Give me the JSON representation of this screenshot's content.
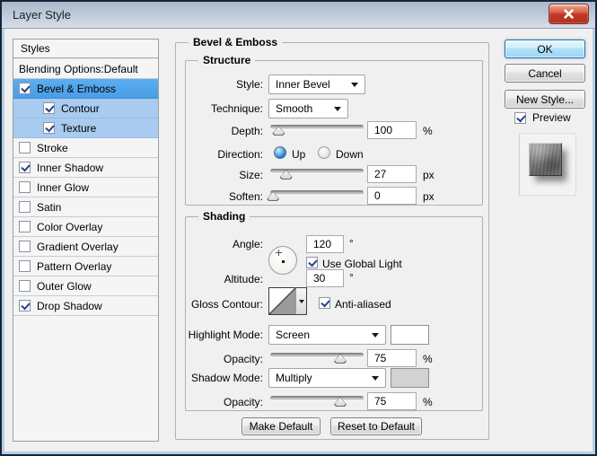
{
  "window": {
    "title": "Layer Style"
  },
  "sidebar": {
    "header": "Styles",
    "items": [
      {
        "label": "Blending Options:Default",
        "checked": null,
        "state": "none",
        "indent": false
      },
      {
        "label": "Bevel & Emboss",
        "checked": true,
        "state": "primary",
        "indent": false
      },
      {
        "label": "Contour",
        "checked": true,
        "state": "secondary",
        "indent": true
      },
      {
        "label": "Texture",
        "checked": true,
        "state": "secondary",
        "indent": true
      },
      {
        "label": "Stroke",
        "checked": false,
        "state": "none",
        "indent": false
      },
      {
        "label": "Inner Shadow",
        "checked": true,
        "state": "none",
        "indent": false
      },
      {
        "label": "Inner Glow",
        "checked": false,
        "state": "none",
        "indent": false
      },
      {
        "label": "Satin",
        "checked": false,
        "state": "none",
        "indent": false
      },
      {
        "label": "Color Overlay",
        "checked": false,
        "state": "none",
        "indent": false
      },
      {
        "label": "Gradient Overlay",
        "checked": false,
        "state": "none",
        "indent": false
      },
      {
        "label": "Pattern Overlay",
        "checked": false,
        "state": "none",
        "indent": false
      },
      {
        "label": "Outer Glow",
        "checked": false,
        "state": "none",
        "indent": false
      },
      {
        "label": "Drop Shadow",
        "checked": true,
        "state": "none",
        "indent": false
      }
    ]
  },
  "bevel": {
    "title": "Bevel & Emboss",
    "structure": {
      "title": "Structure",
      "style": {
        "label": "Style:",
        "value": "Inner Bevel"
      },
      "technique": {
        "label": "Technique:",
        "value": "Smooth"
      },
      "depth": {
        "label": "Depth:",
        "value": "100",
        "unit": "%",
        "pos": 9
      },
      "direction": {
        "label": "Direction:",
        "up": "Up",
        "down": "Down",
        "selected": "up"
      },
      "size": {
        "label": "Size:",
        "value": "27",
        "unit": "px",
        "pos": 17
      },
      "soften": {
        "label": "Soften:",
        "value": "0",
        "unit": "px",
        "pos": 3
      }
    },
    "shading": {
      "title": "Shading",
      "angle": {
        "label": "Angle:",
        "value": "120",
        "unit": "°"
      },
      "use_global_light": {
        "label": "Use Global Light",
        "checked": true
      },
      "altitude": {
        "label": "Altitude:",
        "value": "30",
        "unit": "°"
      },
      "gloss": {
        "label": "Gloss Contour:"
      },
      "anti_aliased": {
        "label": "Anti-aliased",
        "checked": true
      },
      "highlight": {
        "label": "Highlight Mode:",
        "value": "Screen",
        "swatch": "#ffffff"
      },
      "opacity_highlight": {
        "label": "Opacity:",
        "value": "75",
        "unit": "%",
        "pos": 75
      },
      "shadow": {
        "label": "Shadow Mode:",
        "value": "Multiply",
        "swatch": "#d2d2d2"
      },
      "opacity_shadow": {
        "label": "Opacity:",
        "value": "75",
        "unit": "%",
        "pos": 75
      }
    },
    "footer": {
      "make_default": "Make Default",
      "reset_to_default": "Reset to Default"
    }
  },
  "actions": {
    "ok": "OK",
    "cancel": "Cancel",
    "new_style": "New Style...",
    "preview": {
      "label": "Preview",
      "checked": true
    }
  },
  "colors": {
    "selected_row": "#4f9fe8",
    "selected_row_light": "#a8cbef",
    "titlebar_top": "#aab9cb",
    "titlebar_bottom": "#d6dee8",
    "close_button": "#c03a26",
    "ok_border": "#2c6d9e",
    "highlight_swatch": "#ffffff",
    "shadow_swatch": "#d2d2d2"
  }
}
